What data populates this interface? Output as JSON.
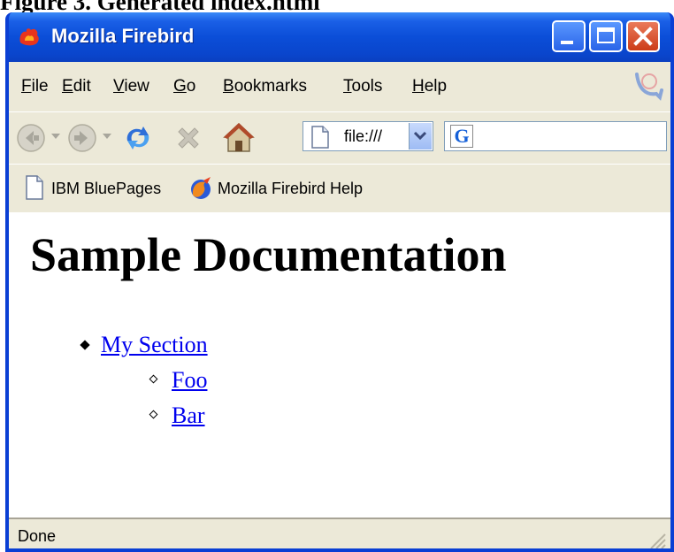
{
  "figure_caption": "Figure 3. Generated index.html",
  "window": {
    "title": "Mozilla Firebird",
    "buttons": [
      "minimize-icon",
      "maximize-icon",
      "close-icon"
    ]
  },
  "menubar": {
    "items": [
      {
        "label": "File",
        "accel": "F",
        "rest": "ile"
      },
      {
        "label": "Edit",
        "accel": "E",
        "rest": "dit"
      },
      {
        "label": "View",
        "accel": "V",
        "rest": "iew"
      },
      {
        "label": "Go",
        "accel": "G",
        "rest": "o"
      },
      {
        "label": "Bookmarks",
        "accel": "B",
        "rest": "ookmarks"
      },
      {
        "label": "Tools",
        "accel": "T",
        "rest": "ools"
      },
      {
        "label": "Help",
        "accel": "H",
        "rest": "elp"
      }
    ]
  },
  "navbar": {
    "buttons": [
      "back-icon",
      "back-dropdown-icon",
      "forward-icon",
      "forward-dropdown-icon",
      "reload-icon",
      "stop-icon",
      "home-icon"
    ],
    "url": "file:///",
    "search_engine_icon": "google-icon",
    "search_engine_glyph": "G",
    "search_value": ""
  },
  "bookmarks": {
    "items": [
      {
        "label": "IBM BluePages",
        "icon": "page-icon"
      },
      {
        "label": "Mozilla Firebird Help",
        "icon": "firebird-icon"
      }
    ]
  },
  "content": {
    "heading": "Sample Documentation",
    "toc": {
      "section": "My Section",
      "subsections": [
        "Foo",
        "Bar"
      ]
    }
  },
  "status": {
    "text": "Done"
  },
  "colors": {
    "titlebar": "#0a4ed8",
    "chrome": "#ece9d8",
    "link": "#0000ee",
    "close_button": "#cc3c18"
  }
}
